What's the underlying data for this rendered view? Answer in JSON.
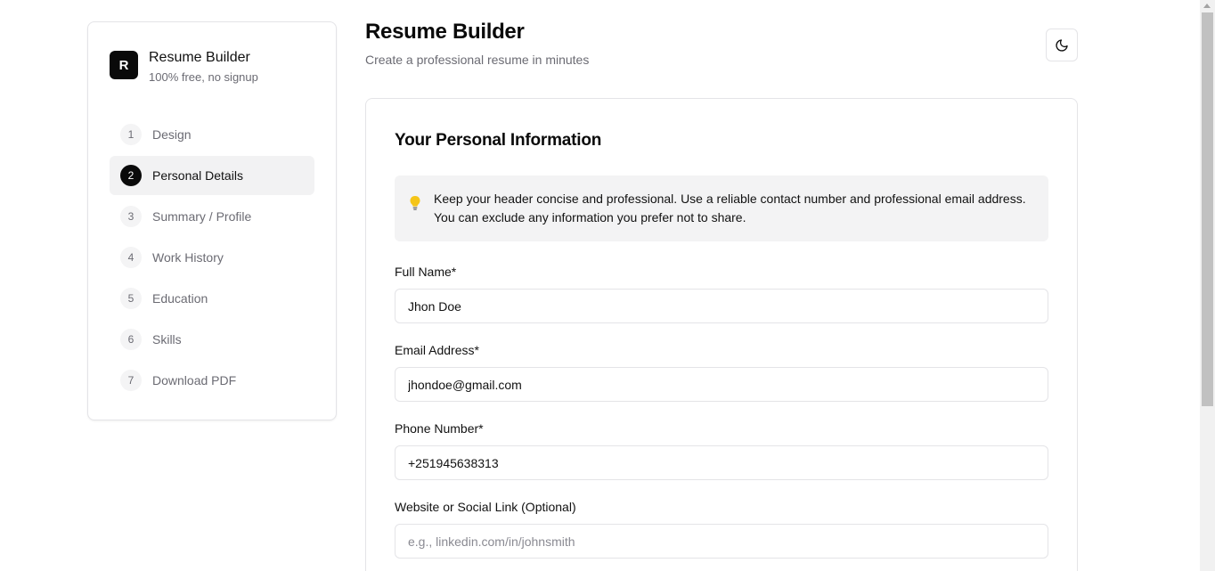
{
  "brand": {
    "logo_letter": "R",
    "title": "Resume Builder",
    "subtitle": "100% free, no signup"
  },
  "steps": [
    {
      "num": "1",
      "label": "Design",
      "active": false
    },
    {
      "num": "2",
      "label": "Personal Details",
      "active": true
    },
    {
      "num": "3",
      "label": "Summary / Profile",
      "active": false
    },
    {
      "num": "4",
      "label": "Work History",
      "active": false
    },
    {
      "num": "5",
      "label": "Education",
      "active": false
    },
    {
      "num": "6",
      "label": "Skills",
      "active": false
    },
    {
      "num": "7",
      "label": "Download PDF",
      "active": false
    }
  ],
  "header": {
    "title": "Resume Builder",
    "subtitle": "Create a professional resume in minutes",
    "theme_icon": "moon-icon"
  },
  "form": {
    "title": "Your Personal Information",
    "tip_icon": "lightbulb-icon",
    "tip_text": "Keep your header concise and professional. Use a reliable contact number and professional email address. You can exclude any information you prefer not to share.",
    "full_name": {
      "label": "Full Name*",
      "value": "Jhon Doe",
      "placeholder": ""
    },
    "email": {
      "label": "Email Address*",
      "value": "jhondoe@gmail.com",
      "placeholder": ""
    },
    "phone": {
      "label": "Phone Number*",
      "value": "+251945638313",
      "placeholder": ""
    },
    "website": {
      "label": "Website or Social Link (Optional)",
      "value": "",
      "placeholder": "e.g., linkedin.com/in/johnsmith"
    }
  },
  "colors": {
    "accent": "#0a0a0a",
    "muted_text": "#6b6b73",
    "border": "#e4e4e7",
    "tip_bg": "#f3f3f4",
    "bulb": "#f5c518"
  }
}
